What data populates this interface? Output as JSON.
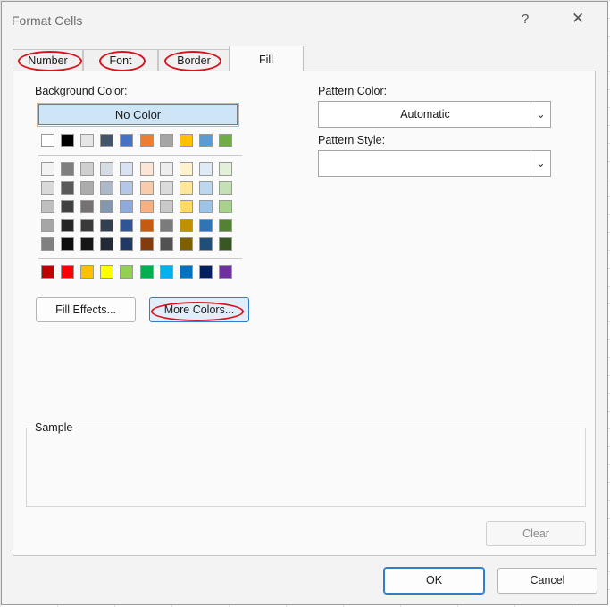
{
  "window": {
    "title": "Format Cells",
    "help_glyph": "?",
    "close_glyph": "✕"
  },
  "tabs": [
    {
      "label": "Number",
      "underline": "N"
    },
    {
      "label": "Font",
      "underline": "F"
    },
    {
      "label": "Border",
      "underline": "B"
    },
    {
      "label": "Fill",
      "underline": "F",
      "active": true
    }
  ],
  "fill": {
    "background_color_label": "Background Color:",
    "no_color_label": "No Color",
    "theme_row": [
      "#ffffff",
      "#000000",
      "#e7e6e6",
      "#44546a",
      "#4472c4",
      "#ed7d31",
      "#a5a5a5",
      "#ffc000",
      "#5b9bd5",
      "#70ad47"
    ],
    "shade_rows": [
      [
        "#f2f2f2",
        "#7f7f7f",
        "#d0cece",
        "#d6dce4",
        "#d9e2f3",
        "#fbe5d6",
        "#ededed",
        "#fff2cc",
        "#deebf7",
        "#e2f0d9"
      ],
      [
        "#d9d9d9",
        "#595959",
        "#aeabab",
        "#adb9ca",
        "#b4c7e7",
        "#f8cbad",
        "#dbdbdb",
        "#ffe699",
        "#bdd7ee",
        "#c5e0b4"
      ],
      [
        "#bfbfbf",
        "#404040",
        "#767171",
        "#8497b0",
        "#8faadc",
        "#f4b183",
        "#c9c9c9",
        "#ffd966",
        "#9dc3e6",
        "#a9d18e"
      ],
      [
        "#a6a6a6",
        "#262626",
        "#3a3838",
        "#323f4f",
        "#2f5597",
        "#c55a11",
        "#7b7b7b",
        "#bf9000",
        "#2e75b6",
        "#548235"
      ],
      [
        "#808080",
        "#0d0d0d",
        "#171616",
        "#222a35",
        "#203864",
        "#843c0c",
        "#525252",
        "#7f6000",
        "#1f4e79",
        "#385723"
      ]
    ],
    "standard_row": [
      "#c00000",
      "#ff0000",
      "#ffc000",
      "#ffff00",
      "#92d050",
      "#00b050",
      "#00b0f0",
      "#0070c0",
      "#002060",
      "#7030a0"
    ],
    "fill_effects_label": "Fill Effects...",
    "more_colors_label": "More Colors...",
    "pattern_color_label": "Pattern Color:",
    "pattern_color_value": "Automatic",
    "pattern_style_label": "Pattern Style:",
    "pattern_style_value": "",
    "sample_label": "Sample",
    "clear_label": "Clear"
  },
  "footer": {
    "ok_label": "OK",
    "cancel_label": "Cancel"
  },
  "accent": {
    "highlight_oval": "#d9121b",
    "selection_blue": "#2f8fd6"
  }
}
